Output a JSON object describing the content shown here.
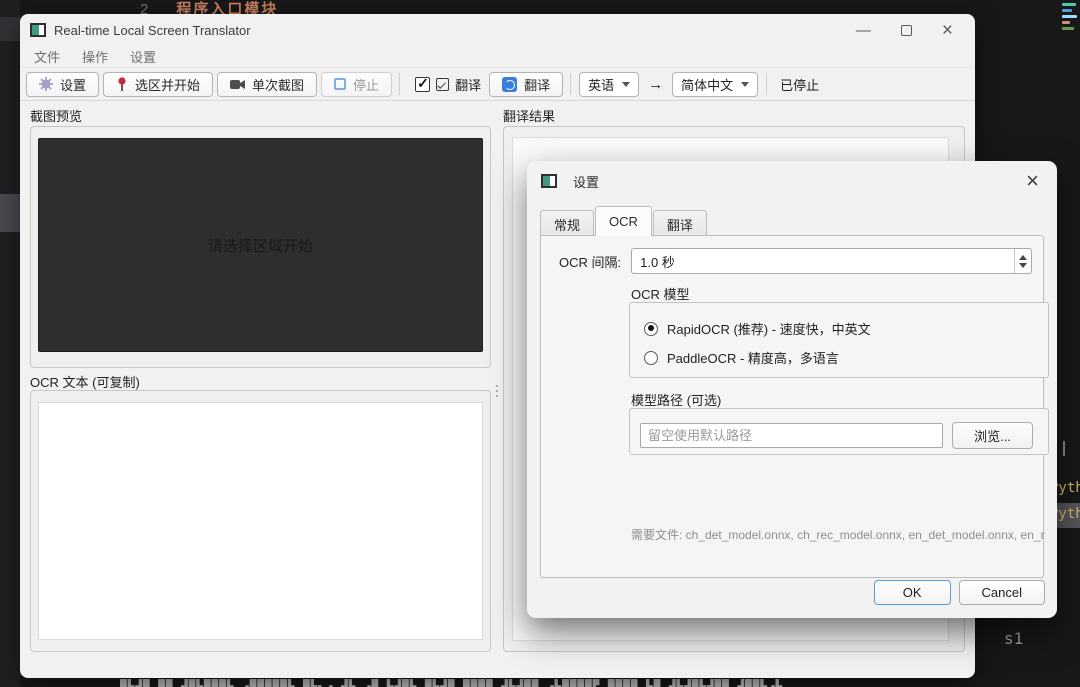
{
  "background": {
    "editor_line_number": "2",
    "editor_comment": "程序入口模块",
    "python_label_top": "Pyth",
    "python_label_selected": "Pyth",
    "code_fragment": "s1",
    "terminal_line": "█▙▟█ ██ ▟█▙███▙ ▗█████▙ █▙▖▗ ▟▙ ▗█ ▙▟█▙ █▙▟█ ████ ▟▙▟██ ▗▙████▛ ████ ▙█ ▟▙▟█▙▟██ ▟██▙▗▙",
    "minimap_colors": [
      "#4ec9b0",
      "#569cd6",
      "#9cdcfe",
      "#ce9178",
      "#6a9955"
    ]
  },
  "window": {
    "title": "Real-time Local Screen Translator",
    "menu": {
      "file": "文件",
      "action": "操作",
      "settings": "设置"
    },
    "toolbar": {
      "settings_btn": "设置",
      "select_start_btn": "选区并开始",
      "single_shot_btn": "单次截图",
      "stop_btn": "停止",
      "translate_check_label": "翻译",
      "translate_btn": "翻译",
      "source_lang": "英语",
      "arrow": "→",
      "target_lang": "简体中文",
      "status": "已停止"
    },
    "left_panel": {
      "preview_label": "截图预览",
      "preview_placeholder": "请选择区域开始",
      "ocr_label": "OCR 文本 (可复制)"
    },
    "right_panel": {
      "result_label": "翻译结果"
    }
  },
  "dialog": {
    "title": "设置",
    "tabs": {
      "general": "常规",
      "ocr": "OCR",
      "translate": "翻译"
    },
    "interval_label": "OCR 间隔:",
    "interval_value": "1.0 秒",
    "model_group_title": "OCR 模型",
    "radio_rapidocr": "RapidOCR (推荐) - 速度快，中英文",
    "radio_paddleocr": "PaddleOCR - 精度高，多语言",
    "path_group_title": "模型路径 (可选)",
    "path_placeholder": "留空使用默认路径",
    "browse_btn": "浏览...",
    "hint": "需要文件: ch_det_model.onnx, ch_rec_model.onnx, en_det_model.onnx, en_r",
    "ok_btn": "OK",
    "cancel_btn": "Cancel"
  },
  "colors": {
    "accent_blue": "#3b7dd8",
    "pin_red": "#c62a3f",
    "gear_purple": "#a89cc8",
    "stop_blue": "#7ab0e8",
    "editor_comment": "#c8805f",
    "python_yellow": "#d8ba6e"
  }
}
